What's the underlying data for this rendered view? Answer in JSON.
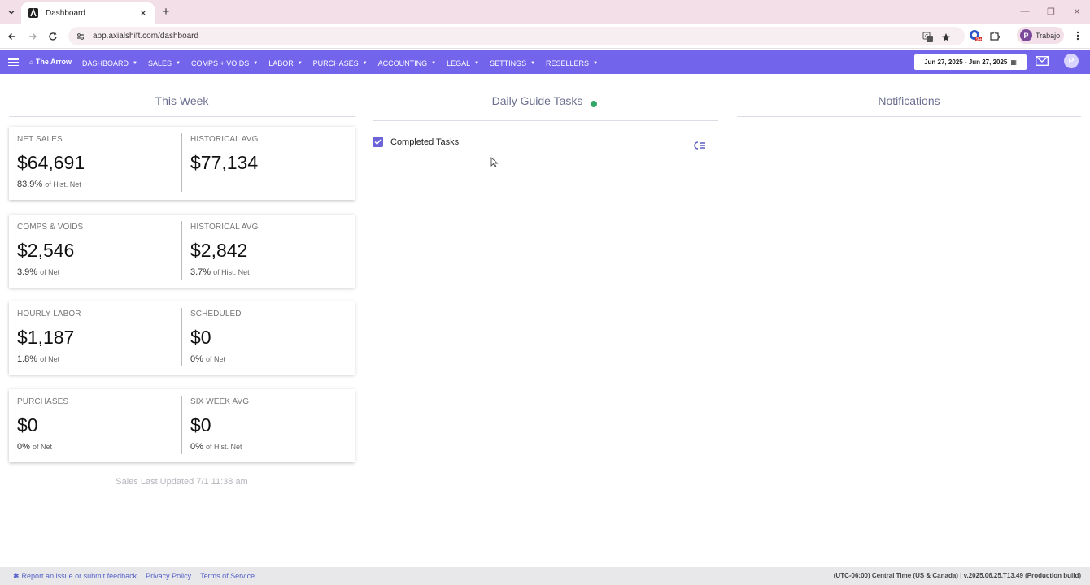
{
  "browser": {
    "tab_title": "Dashboard",
    "url": "app.axialshift.com/dashboard",
    "profile_name": "Trabajo",
    "profile_initial": "P",
    "extension_badge": "9+"
  },
  "nav": {
    "brand": "The Arrow",
    "items": [
      {
        "label": "DASHBOARD"
      },
      {
        "label": "SALES"
      },
      {
        "label": "COMPS + VOIDS"
      },
      {
        "label": "LABOR"
      },
      {
        "label": "PURCHASES"
      },
      {
        "label": "ACCOUNTING"
      },
      {
        "label": "LEGAL"
      },
      {
        "label": "SETTINGS"
      },
      {
        "label": "RESELLERS"
      }
    ],
    "date_range": "Jun 27, 2025 - Jun 27, 2025",
    "user_initial": "P"
  },
  "columns": {
    "this_week": "This Week",
    "daily_tasks": "Daily Guide Tasks",
    "notifications": "Notifications"
  },
  "cards": [
    {
      "left": {
        "label": "NET SALES",
        "value": "$64,691",
        "pct": "83.9%",
        "sub": "of Hist. Net"
      },
      "right": {
        "label": "HISTORICAL AVG",
        "value": "$77,134",
        "pct": "",
        "sub": ""
      }
    },
    {
      "left": {
        "label": "COMPS & VOIDS",
        "value": "$2,546",
        "pct": "3.9%",
        "sub": "of Net"
      },
      "right": {
        "label": "HISTORICAL AVG",
        "value": "$2,842",
        "pct": "3.7%",
        "sub": "of Hist. Net"
      }
    },
    {
      "left": {
        "label": "HOURLY LABOR",
        "value": "$1,187",
        "pct": "1.8%",
        "sub": "of Net"
      },
      "right": {
        "label": "SCHEDULED",
        "value": "$0",
        "pct": "0%",
        "sub": "of Net"
      }
    },
    {
      "left": {
        "label": "PURCHASES",
        "value": "$0",
        "pct": "0%",
        "sub": "of Net"
      },
      "right": {
        "label": "SIX WEEK AVG",
        "value": "$0",
        "pct": "0%",
        "sub": "of Hist. Net"
      }
    }
  ],
  "sales_updated": "Sales Last Updated 7/1 11:38 am",
  "tasks": {
    "completed_label": "Completed Tasks",
    "completed_checked": true
  },
  "footer": {
    "report_link": "Report an issue or submit feedback",
    "privacy_link": "Privacy Policy",
    "terms_link": "Terms of Service",
    "build_info": "(UTC-06:00) Central Time (US & Canada) | v.2025.06.25.T13.49 (Production build)"
  },
  "colors": {
    "nav_bg": "#7265ec",
    "accent": "#6c63d8",
    "status_ok": "#2fa865"
  }
}
